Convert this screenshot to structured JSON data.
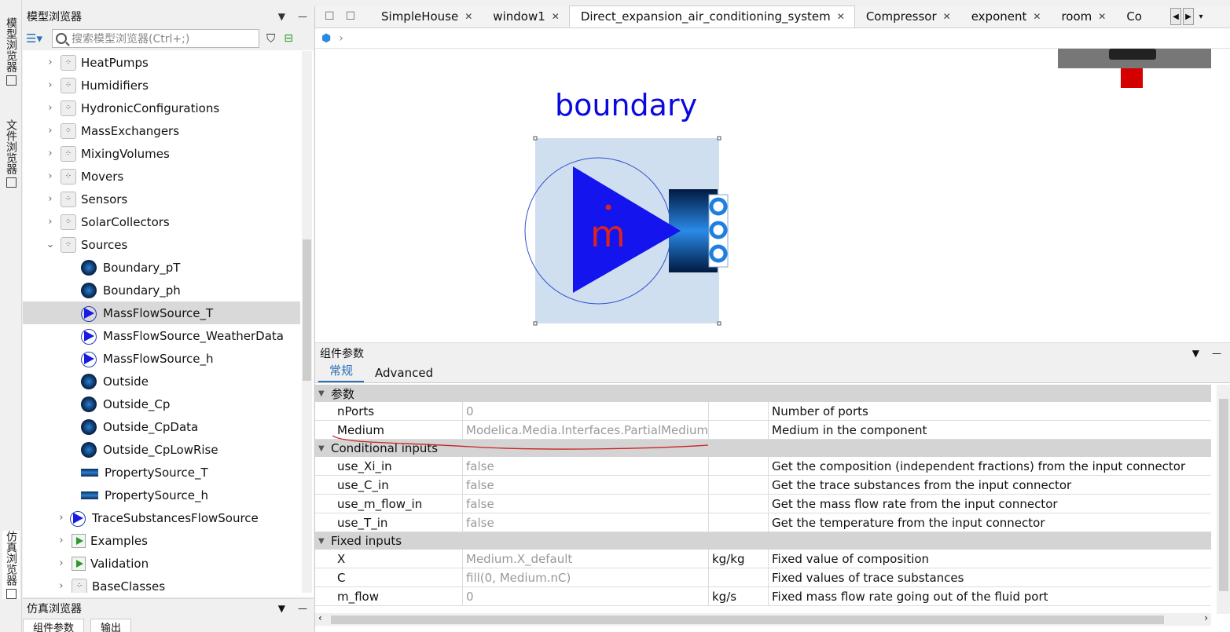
{
  "side_dock": {
    "model_browser_tab": "模型浏览器",
    "file_browser_tab": "文件浏览器",
    "sim_browser_tab": "仿真浏览器"
  },
  "model_browser": {
    "title": "模型浏览器",
    "search_placeholder": "搜索模型浏览器(Ctrl+;)",
    "items": [
      {
        "label": "HeatPumps",
        "type": "package",
        "expanded": false
      },
      {
        "label": "Humidifiers",
        "type": "package",
        "expanded": false
      },
      {
        "label": "HydronicConfigurations",
        "type": "package",
        "expanded": false
      },
      {
        "label": "MassExchangers",
        "type": "package",
        "expanded": false
      },
      {
        "label": "MixingVolumes",
        "type": "package",
        "expanded": false
      },
      {
        "label": "Movers",
        "type": "package",
        "expanded": false
      },
      {
        "label": "Sensors",
        "type": "package",
        "expanded": false
      },
      {
        "label": "SolarCollectors",
        "type": "package",
        "expanded": false
      },
      {
        "label": "Sources",
        "type": "package",
        "expanded": true
      },
      {
        "label": "Boundary_pT",
        "type": "circle"
      },
      {
        "label": "Boundary_ph",
        "type": "circle"
      },
      {
        "label": "MassFlowSource_T",
        "type": "triangle",
        "selected": true
      },
      {
        "label": "MassFlowSource_WeatherData",
        "type": "triangle"
      },
      {
        "label": "MassFlowSource_h",
        "type": "triangle"
      },
      {
        "label": "Outside",
        "type": "circle"
      },
      {
        "label": "Outside_Cp",
        "type": "circle"
      },
      {
        "label": "Outside_CpData",
        "type": "circle"
      },
      {
        "label": "Outside_CpLowRise",
        "type": "circle"
      },
      {
        "label": "PropertySource_T",
        "type": "bar"
      },
      {
        "label": "PropertySource_h",
        "type": "bar"
      },
      {
        "label": "TraceSubstancesFlowSource",
        "type": "triangle",
        "collapsible": true
      },
      {
        "label": "Examples",
        "type": "play"
      },
      {
        "label": "Validation",
        "type": "play"
      },
      {
        "label": "BaseClasses",
        "type": "package"
      }
    ]
  },
  "sim_browser": {
    "title": "仿真浏览器",
    "bottom_tabs": [
      "组件参数",
      "输出"
    ]
  },
  "editor": {
    "tabs": [
      {
        "label": "SimpleHouse",
        "active": false
      },
      {
        "label": "window1",
        "active": false
      },
      {
        "label": "Direct_expansion_air_conditioning_system",
        "active": true
      },
      {
        "label": "Compressor",
        "active": false
      },
      {
        "label": "exponent",
        "active": false
      },
      {
        "label": "room",
        "active": false
      },
      {
        "label": "Co",
        "active": false
      }
    ],
    "component_label": "boundary",
    "component_symbol": "m"
  },
  "params": {
    "title": "组件参数",
    "tabs": [
      "常规",
      "Advanced"
    ],
    "groups": [
      {
        "name": "参数",
        "rows": [
          {
            "name": "nPorts",
            "value": "0",
            "unit": "",
            "desc": "Number of ports"
          },
          {
            "name": "Medium",
            "value": "Modelica.Media.Interfaces.PartialMedium",
            "unit": "",
            "desc": "Medium in the component"
          }
        ]
      },
      {
        "name": "Conditional inputs",
        "rows": [
          {
            "name": "use_Xi_in",
            "value": "false",
            "unit": "",
            "desc": "Get the composition (independent fractions) from the input connector"
          },
          {
            "name": "use_C_in",
            "value": "false",
            "unit": "",
            "desc": "Get the trace substances from the input connector"
          },
          {
            "name": "use_m_flow_in",
            "value": "false",
            "unit": "",
            "desc": "Get the mass flow rate from the input connector"
          },
          {
            "name": "use_T_in",
            "value": "false",
            "unit": "",
            "desc": "Get the temperature from the input connector"
          }
        ]
      },
      {
        "name": "Fixed inputs",
        "rows": [
          {
            "name": "X",
            "value": "Medium.X_default",
            "unit": "kg/kg",
            "desc": "Fixed value of composition"
          },
          {
            "name": "C",
            "value": "fill(0, Medium.nC)",
            "unit": "",
            "desc": "Fixed values of trace substances"
          },
          {
            "name": "m_flow",
            "value": "0",
            "unit": "kg/s",
            "desc": "Fixed mass flow rate going out of the fluid port"
          }
        ]
      }
    ]
  },
  "colors": {
    "accent": "#2a6fb8",
    "component_blue": "#1a1ae6",
    "label_blue": "#0a0ae0",
    "annotation_red": "#cc2222"
  }
}
